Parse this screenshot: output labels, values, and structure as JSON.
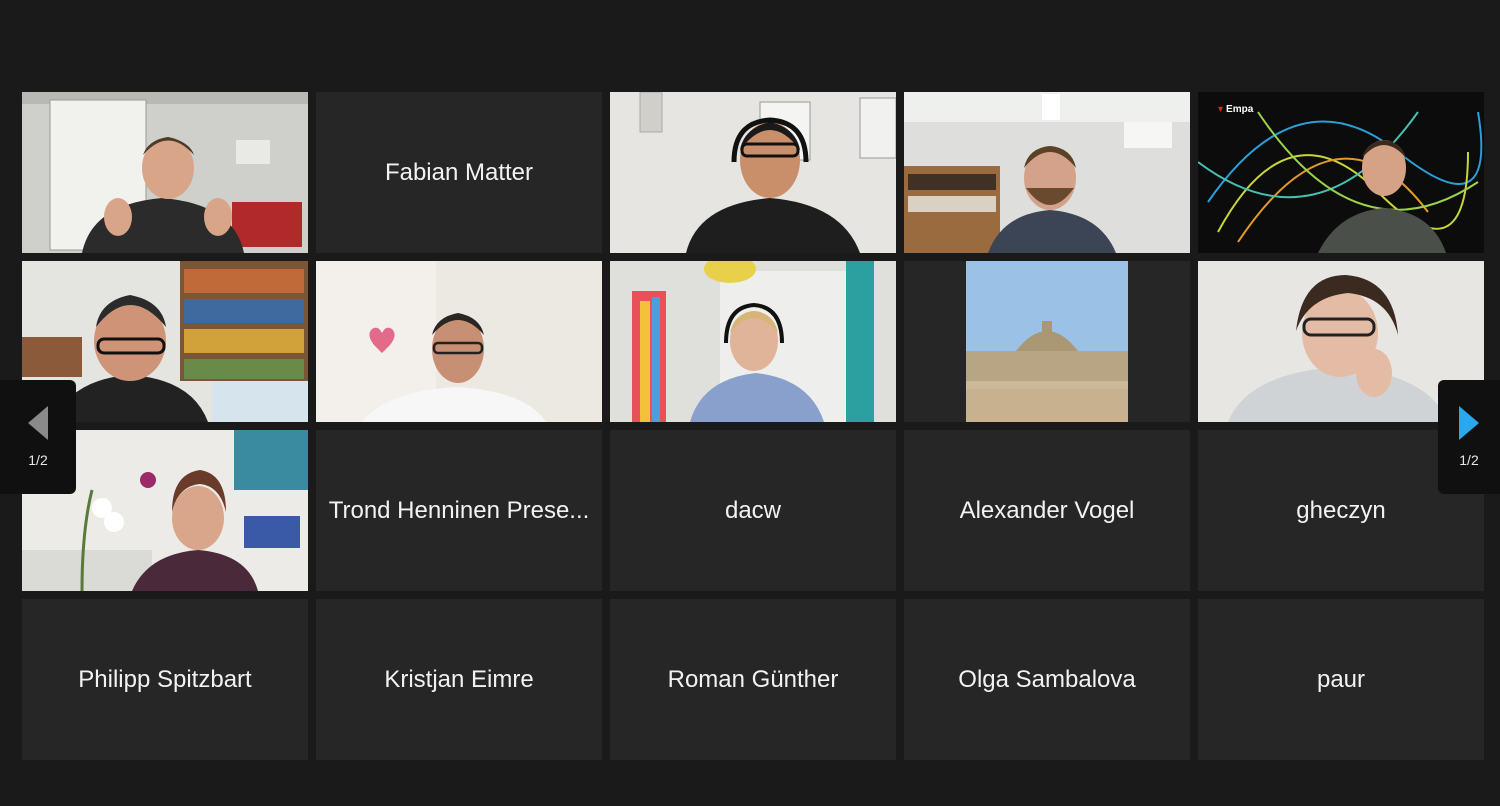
{
  "gallery": {
    "tiles": [
      {
        "kind": "video",
        "participant": "speaker-office-flipchart"
      },
      {
        "kind": "name",
        "label": "Fabian Matter"
      },
      {
        "kind": "video",
        "participant": "man-headphones"
      },
      {
        "kind": "video",
        "participant": "bearded-man-office"
      },
      {
        "kind": "video",
        "participant": "man-empa-background"
      },
      {
        "kind": "video",
        "participant": "man-glasses-bookshelf"
      },
      {
        "kind": "video",
        "participant": "man-heart-wall"
      },
      {
        "kind": "video",
        "participant": "woman-headset"
      },
      {
        "kind": "image",
        "participant": "eth-building-photo"
      },
      {
        "kind": "video",
        "participant": "woman-glasses"
      },
      {
        "kind": "video",
        "participant": "woman-headset-orchids"
      },
      {
        "kind": "name",
        "label": "Trond Henninen Prese..."
      },
      {
        "kind": "name",
        "label": "dacw"
      },
      {
        "kind": "name",
        "label": "Alexander Vogel"
      },
      {
        "kind": "name",
        "label": "gheczyn"
      },
      {
        "kind": "name",
        "label": "Philipp Spitzbart"
      },
      {
        "kind": "name",
        "label": "Kristjan Eimre"
      },
      {
        "kind": "name",
        "label": "Roman Günther"
      },
      {
        "kind": "name",
        "label": "Olga Sambalova"
      },
      {
        "kind": "name",
        "label": "paur"
      }
    ]
  },
  "empa_logo_text": "Empa",
  "pager": {
    "left_label": "1/2",
    "right_label": "1/2"
  },
  "colors": {
    "background": "#1a1a1a",
    "tile": "#262626",
    "active_speaker_border": "#d8e889",
    "next_arrow": "#2aa8ee"
  }
}
